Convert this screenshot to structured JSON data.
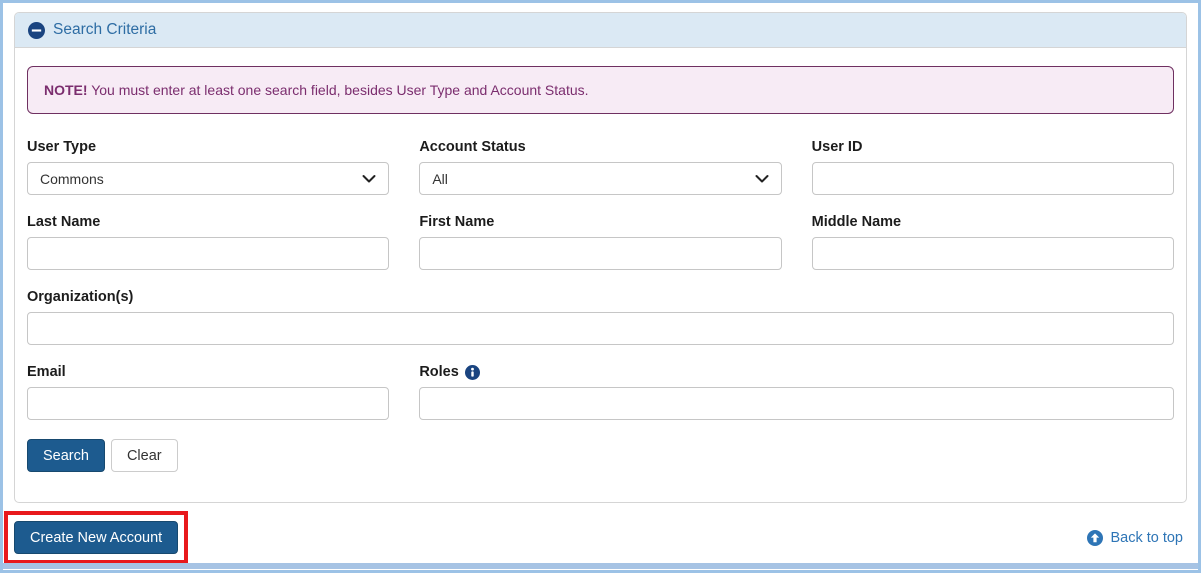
{
  "panel": {
    "title": "Search Criteria"
  },
  "note": {
    "prefix": "NOTE!",
    "text": "You must enter at least one search field, besides User Type and Account Status."
  },
  "fields": {
    "user_type": {
      "label": "User Type",
      "value": "Commons"
    },
    "account_status": {
      "label": "Account Status",
      "value": "All"
    },
    "user_id": {
      "label": "User ID",
      "value": ""
    },
    "last_name": {
      "label": "Last Name",
      "value": ""
    },
    "first_name": {
      "label": "First Name",
      "value": ""
    },
    "middle_name": {
      "label": "Middle Name",
      "value": ""
    },
    "organizations": {
      "label": "Organization(s)",
      "value": ""
    },
    "email": {
      "label": "Email",
      "value": ""
    },
    "roles": {
      "label": "Roles",
      "value": ""
    }
  },
  "buttons": {
    "search": "Search",
    "clear": "Clear",
    "create_new_account": "Create New Account"
  },
  "links": {
    "back_to_top": "Back to top"
  },
  "icons": {
    "collapse": "minus-circle-icon",
    "roles_info": "info-circle-icon",
    "back_to_top": "arrow-circle-up-icon",
    "dropdown": "chevron-down-icon"
  },
  "colors": {
    "primary_button": "#1d5b8f",
    "panel_header_bg": "#dbe9f4",
    "panel_header_text": "#2e6da4",
    "note_bg": "#f7ebf5",
    "note_border": "#6f3061",
    "note_text": "#7b2d6e",
    "highlight_red": "#e8191c",
    "link_blue": "#2e75b6",
    "frame_blue": "#9cc2e6",
    "icon_navy": "#1a4480"
  }
}
